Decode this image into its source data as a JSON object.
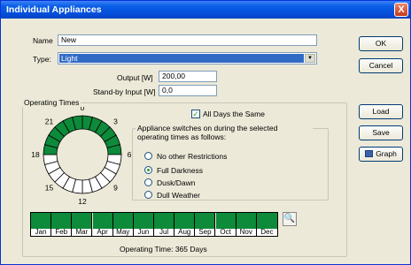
{
  "window": {
    "title": "Individual Appliances",
    "close_glyph": "X"
  },
  "form": {
    "name_label": "Name",
    "name_value": "New",
    "type_label": "Type:",
    "type_value": "Light",
    "output_label": "Output [W]",
    "output_value": "200,00",
    "standby_label": "Stand-by Input [W]",
    "standby_value": "0,0"
  },
  "buttons": {
    "ok": "OK",
    "cancel": "Cancel",
    "load": "Load",
    "save": "Save",
    "graph": "Graph"
  },
  "operating_times": {
    "group_title": "Operating Times",
    "dial_labels": [
      "0",
      "3",
      "6",
      "9",
      "12",
      "15",
      "18",
      "21"
    ],
    "active_hours": [
      0,
      1,
      2,
      3,
      4,
      5,
      18,
      19,
      20,
      21,
      22,
      23
    ],
    "all_days_label": "All Days the Same",
    "all_days_checked": true,
    "switch_group_title": "Appliance switches on during the selected operating times as follows:",
    "options": [
      "No other Restrictions",
      "Full Darkness",
      "Dusk/Dawn",
      "Dull Weather"
    ],
    "selected_option": "Full Darkness",
    "months": [
      "Jan",
      "Feb",
      "Mar",
      "Apr",
      "May",
      "Jun",
      "Jul",
      "Aug",
      "Sep",
      "Oct",
      "Nov",
      "Dec"
    ],
    "summary": "Operating Time: 365 Days"
  },
  "colors": {
    "active": "#0d8a3a",
    "accent": "#316ac5",
    "titlebar": "#0550dc"
  }
}
